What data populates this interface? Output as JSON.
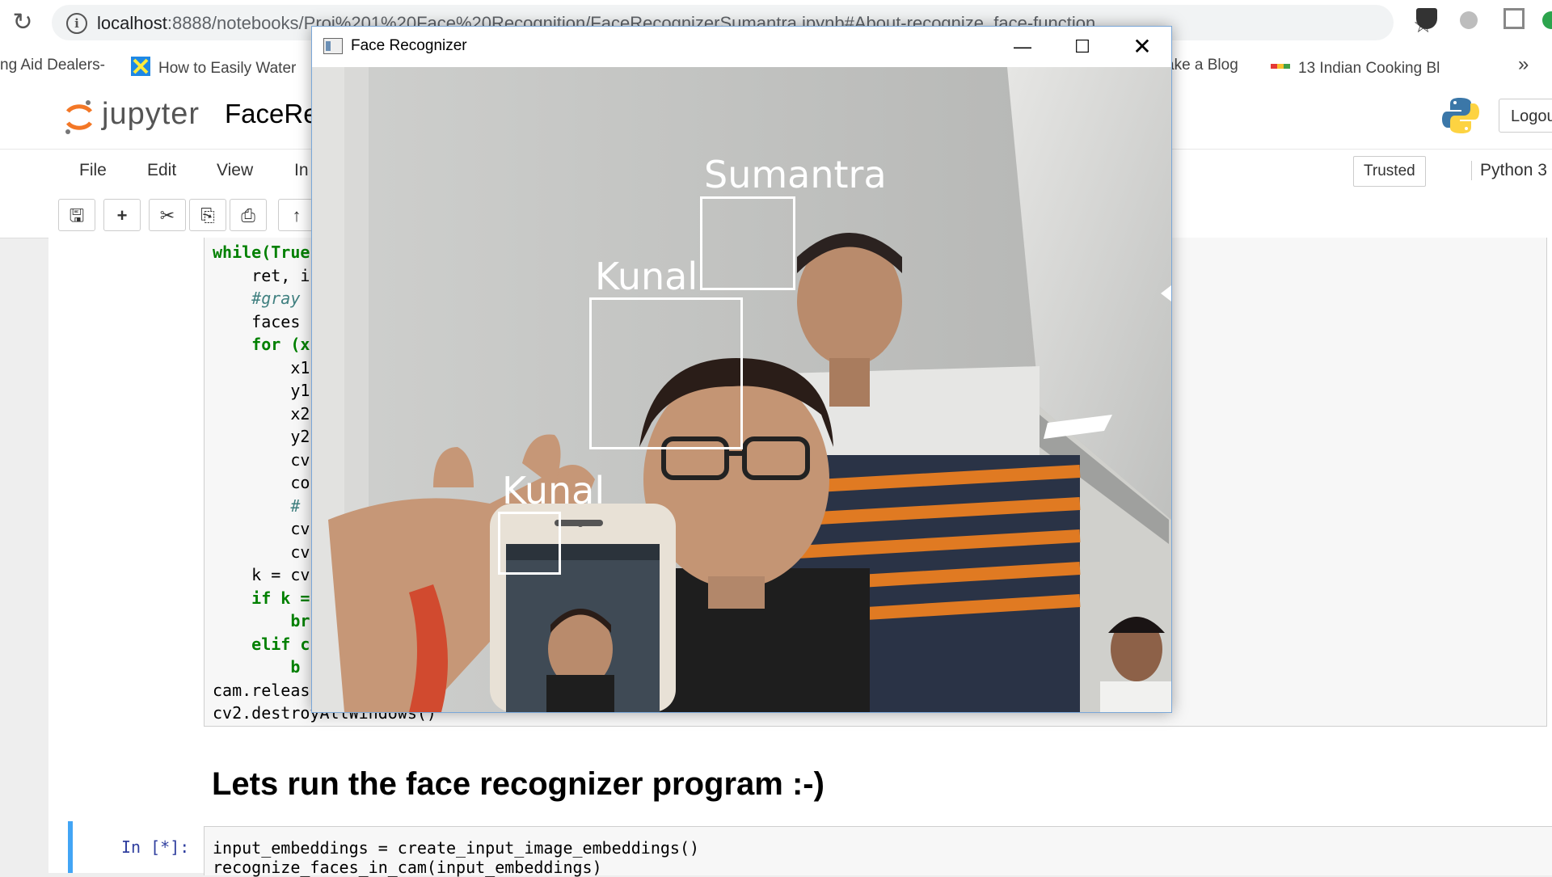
{
  "browser": {
    "url_host": "localhost",
    "url_rest": ":8888/notebooks/Proj%201%20Face%20Recognition/FaceRecognizerSumantra.ipynb#About-recognize_face-function",
    "bookmarks": [
      {
        "label": "ng Aid Dealers-",
        "icon": "bookmark-page-icon"
      },
      {
        "label": "How to Easily Water",
        "icon": "bookmark-star-icon"
      },
      {
        "label": "ake a Blog",
        "icon": ""
      },
      {
        "label": "13 Indian Cooking Bl",
        "icon": "bookmark-colorbar-icon"
      }
    ],
    "more_label": "»"
  },
  "jupyter": {
    "logo_text": "jupyter",
    "notebook_name": "FaceRe",
    "logout_label": "Logou",
    "menu": [
      "File",
      "Edit",
      "View",
      "In"
    ],
    "trusted_label": "Trusted",
    "kernel_label": "Python 3"
  },
  "code_cell": {
    "lines": [
      {
        "text": "while(True",
        "style": "kw-start"
      },
      {
        "text": "    ret, i",
        "style": "plain"
      },
      {
        "text": "    #gray",
        "style": "comment"
      },
      {
        "text": "    faces",
        "style": "plain"
      },
      {
        "text": "    for (x",
        "style": "kw-indent"
      },
      {
        "text": "        x1",
        "style": "plain"
      },
      {
        "text": "        y1",
        "style": "plain"
      },
      {
        "text": "        x2",
        "style": "plain"
      },
      {
        "text": "        y2",
        "style": "plain"
      },
      {
        "text": "        cv",
        "style": "plain"
      },
      {
        "text": "        co",
        "style": "plain"
      },
      {
        "text": "        #",
        "style": "comment"
      },
      {
        "text": "        cv",
        "style": "plain"
      },
      {
        "text": "        cv",
        "style": "plain"
      },
      {
        "text": "    k = cv",
        "style": "plain"
      },
      {
        "text": "    if k =",
        "style": "kw-indent"
      },
      {
        "text": "        br",
        "style": "kw-deep"
      },
      {
        "text": "    elif c",
        "style": "kw-indent"
      },
      {
        "text": "        b",
        "style": "kw-deep"
      },
      {
        "text": "cam.releas",
        "style": "plain"
      },
      {
        "text": "cv2.destroyAllWindows()",
        "style": "plain"
      }
    ]
  },
  "markdown": {
    "heading": "Lets run the face recognizer program :-)"
  },
  "code_cell_2": {
    "prompt": "In [*]:",
    "line1": "input_embeddings = create_input_image_embeddings()",
    "line2": "recognize_faces_in_cam(input_embeddings)"
  },
  "face_window": {
    "title": "Face Recognizer",
    "minimize": "—",
    "maximize": "☐",
    "close": "✕",
    "detections": [
      {
        "label": "Sumantra"
      },
      {
        "label": "Kunal"
      },
      {
        "label": "Kunal"
      }
    ]
  }
}
